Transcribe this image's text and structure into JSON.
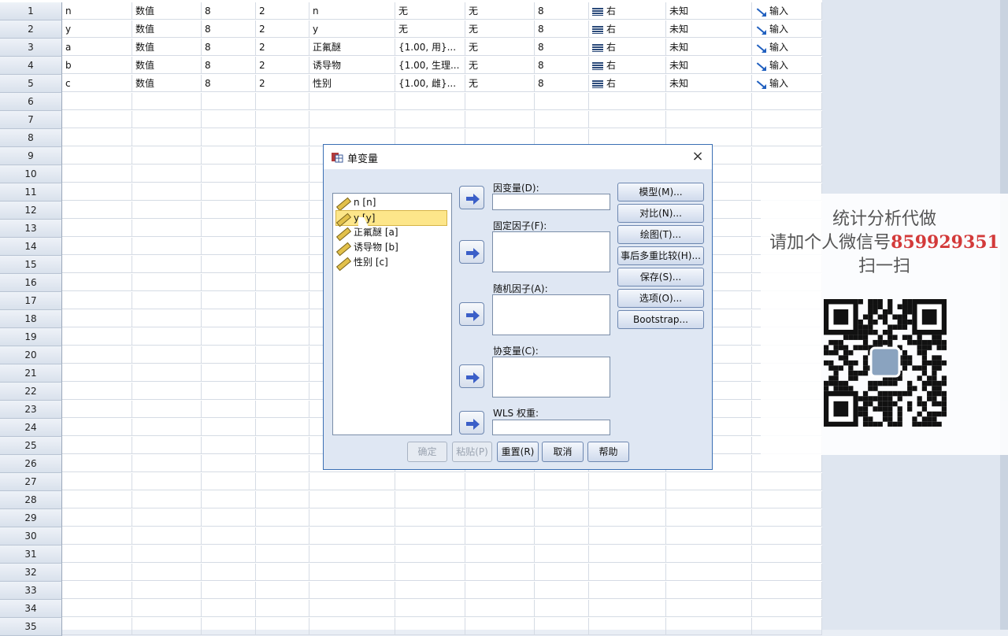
{
  "sheet": {
    "rows": [
      [
        "n",
        "数值",
        "8",
        "2",
        "n",
        "无",
        "无",
        "8",
        "右",
        "未知",
        "输入"
      ],
      [
        "y",
        "数值",
        "8",
        "2",
        "y",
        "无",
        "无",
        "8",
        "右",
        "未知",
        "输入"
      ],
      [
        "a",
        "数值",
        "8",
        "2",
        "正氟醚",
        "{1.00, 用}...",
        "无",
        "8",
        "右",
        "未知",
        "输入"
      ],
      [
        "b",
        "数值",
        "8",
        "2",
        "诱导物",
        "{1.00, 生理...",
        "无",
        "8",
        "右",
        "未知",
        "输入"
      ],
      [
        "c",
        "数值",
        "8",
        "2",
        "性别",
        "{1.00, 雌}...",
        "无",
        "8",
        "右",
        "未知",
        "输入"
      ]
    ],
    "row_numbers": [
      "1",
      "2",
      "3",
      "4",
      "5",
      "6",
      "7",
      "8",
      "9",
      "10",
      "11",
      "12",
      "13",
      "14",
      "15",
      "16",
      "17",
      "18",
      "19",
      "20",
      "21",
      "22",
      "23",
      "24",
      "25",
      "26",
      "27",
      "28",
      "29",
      "30",
      "31",
      "32",
      "33",
      "34",
      "35"
    ]
  },
  "dialog": {
    "title": "单变量",
    "close": "×",
    "variables": [
      "n [n]",
      "y [y]",
      "正氟醚 [a]",
      "诱导物 [b]",
      "性别 [c]"
    ],
    "selected_variable": "y [y]",
    "fields": {
      "dependent": "因变量(D):",
      "fixed": "固定因子(F):",
      "random": "随机因子(A):",
      "covariate": "协变量(C):",
      "wls": "WLS 权重:"
    },
    "side_buttons": [
      "模型(M)...",
      "对比(N)...",
      "绘图(T)...",
      "事后多重比较(H)...",
      "保存(S)...",
      "选项(O)...",
      "Bootstrap..."
    ],
    "bottom_buttons": {
      "ok": "确定",
      "paste": "粘贴(P)",
      "reset": "重置(R)",
      "cancel": "取消",
      "help": "帮助"
    }
  },
  "overlay": {
    "line1": "统计分析代做",
    "line2_prefix": "请加个人微信号",
    "line2_number": "859929351",
    "line3": "扫一扫"
  },
  "icons": [
    "align-right-icon",
    "input-role-icon",
    "scale-ruler-icon",
    "move-arrow-icon",
    "dialog-app-icon",
    "close-icon",
    "qr-code-icon",
    "mouse-cursor-icon"
  ],
  "colors": {
    "accent": "#3a6fb4",
    "selection": "#fde68a",
    "watermark_red": "#d33a3a"
  }
}
